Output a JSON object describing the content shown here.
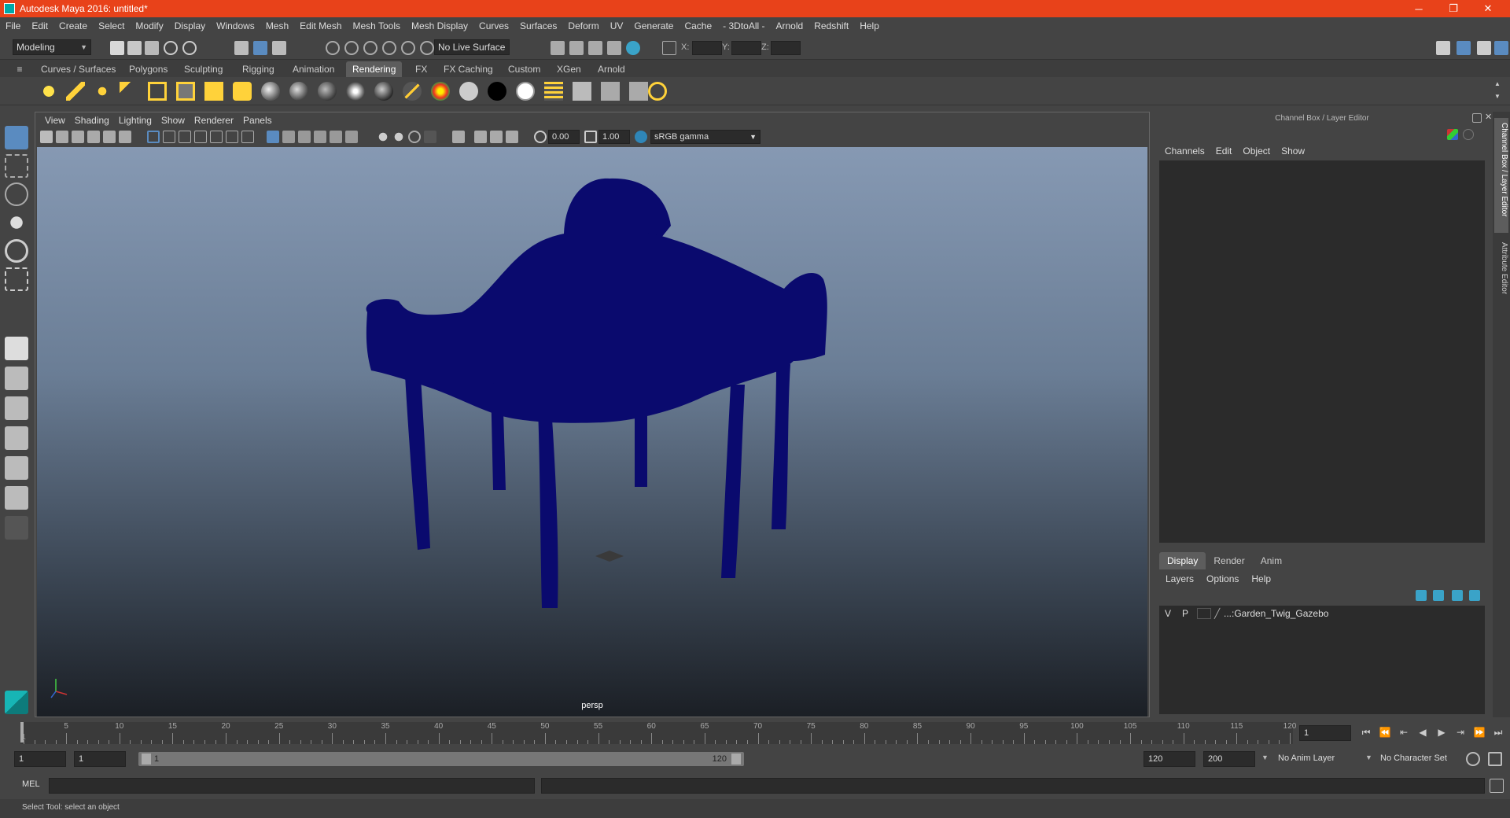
{
  "window": {
    "title": "Autodesk Maya 2016: untitled*",
    "minimize": "─",
    "maximize": "❐",
    "close": "✕"
  },
  "menubar": [
    "File",
    "Edit",
    "Create",
    "Select",
    "Modify",
    "Display",
    "Windows",
    "Mesh",
    "Edit Mesh",
    "Mesh Tools",
    "Mesh Display",
    "Curves",
    "Surfaces",
    "Deform",
    "UV",
    "Generate",
    "Cache",
    "- 3DtoAll -",
    "Arnold",
    "Redshift",
    "Help"
  ],
  "status_line": {
    "menuset": "Modeling",
    "live_surface": "No Live Surface",
    "x_label": "X:",
    "y_label": "Y:",
    "z_label": "Z:"
  },
  "shelf_tabs": [
    "Curves / Surfaces",
    "Polygons",
    "Sculpting",
    "Rigging",
    "Animation",
    "Rendering",
    "FX",
    "FX Caching",
    "Custom",
    "XGen",
    "Arnold"
  ],
  "active_shelf_tab": "Rendering",
  "viewport": {
    "menu": [
      "View",
      "Shading",
      "Lighting",
      "Show",
      "Renderer",
      "Panels"
    ],
    "exposure": "0.00",
    "gamma": "1.00",
    "color_space": "sRGB gamma",
    "camera": "persp",
    "object_color": "#0a0a6e"
  },
  "channel_box": {
    "title": "Channel Box / Layer Editor",
    "menu": [
      "Channels",
      "Edit",
      "Object",
      "Show"
    ]
  },
  "layer_editor": {
    "tabs": [
      "Display",
      "Render",
      "Anim"
    ],
    "active_tab": "Display",
    "menu": [
      "Layers",
      "Options",
      "Help"
    ],
    "layers": [
      {
        "v": "V",
        "p": "P",
        "name": "...:Garden_Twig_Gazebo"
      }
    ]
  },
  "side_tabs": [
    "Channel Box / Layer Editor",
    "Attribute Editor"
  ],
  "timeline": {
    "ticks": [
      5,
      10,
      15,
      20,
      25,
      30,
      35,
      40,
      45,
      50,
      55,
      60,
      65,
      70,
      75,
      80,
      85,
      90,
      95,
      100,
      105,
      110,
      115,
      120
    ],
    "start_label": "1",
    "current_frame": "1"
  },
  "range": {
    "start": "1",
    "playback_start": "1",
    "slider_start": "1",
    "slider_end": "120",
    "playback_end": "120",
    "end": "200",
    "anim_layer": "No Anim Layer",
    "character_set": "No Character Set"
  },
  "command_line": {
    "label": "MEL"
  },
  "help_line": "Select Tool: select an object"
}
